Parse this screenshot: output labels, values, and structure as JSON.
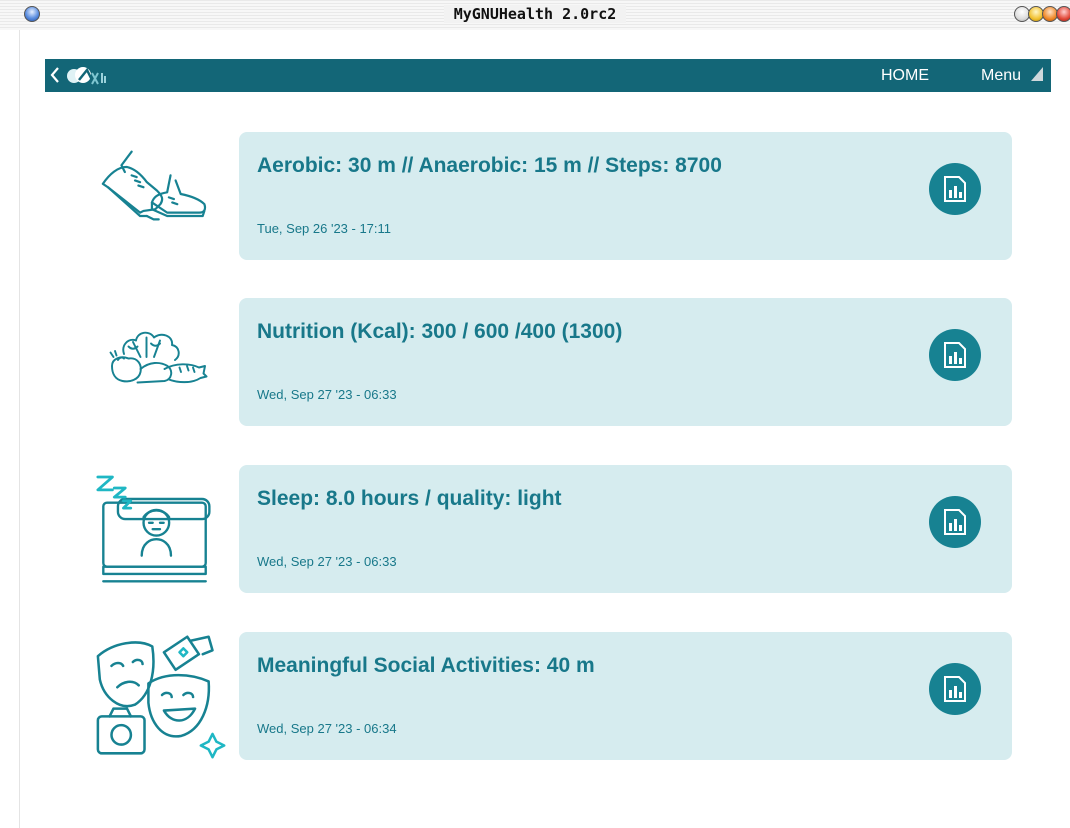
{
  "window": {
    "title": "MyGNUHealth 2.0rc2"
  },
  "header": {
    "home_label": "HOME",
    "menu_label": "Menu"
  },
  "colors": {
    "header_bg": "#136677",
    "card_bg": "#d6ecef",
    "accent_text": "#18788a",
    "chart_button": "#178292"
  },
  "entries": [
    {
      "icon": "sneaker-icon",
      "headline": "Aerobic: 30 m // Anaerobic: 15 m // Steps: 8700",
      "date": "Tue, Sep 26 '23 - 17:11"
    },
    {
      "icon": "vegetables-icon",
      "headline": "Nutrition (Kcal): 300 / 600 /400 (1300)",
      "date": "Wed, Sep 27 '23 - 06:33"
    },
    {
      "icon": "sleeping-person-icon",
      "headline": "Sleep: 8.0 hours / quality: light",
      "date": "Wed, Sep 27 '23 - 06:33"
    },
    {
      "icon": "theater-masks-icon",
      "headline": "Meaningful Social Activities: 40 m",
      "date": "Wed, Sep 27 '23 - 06:34"
    }
  ]
}
